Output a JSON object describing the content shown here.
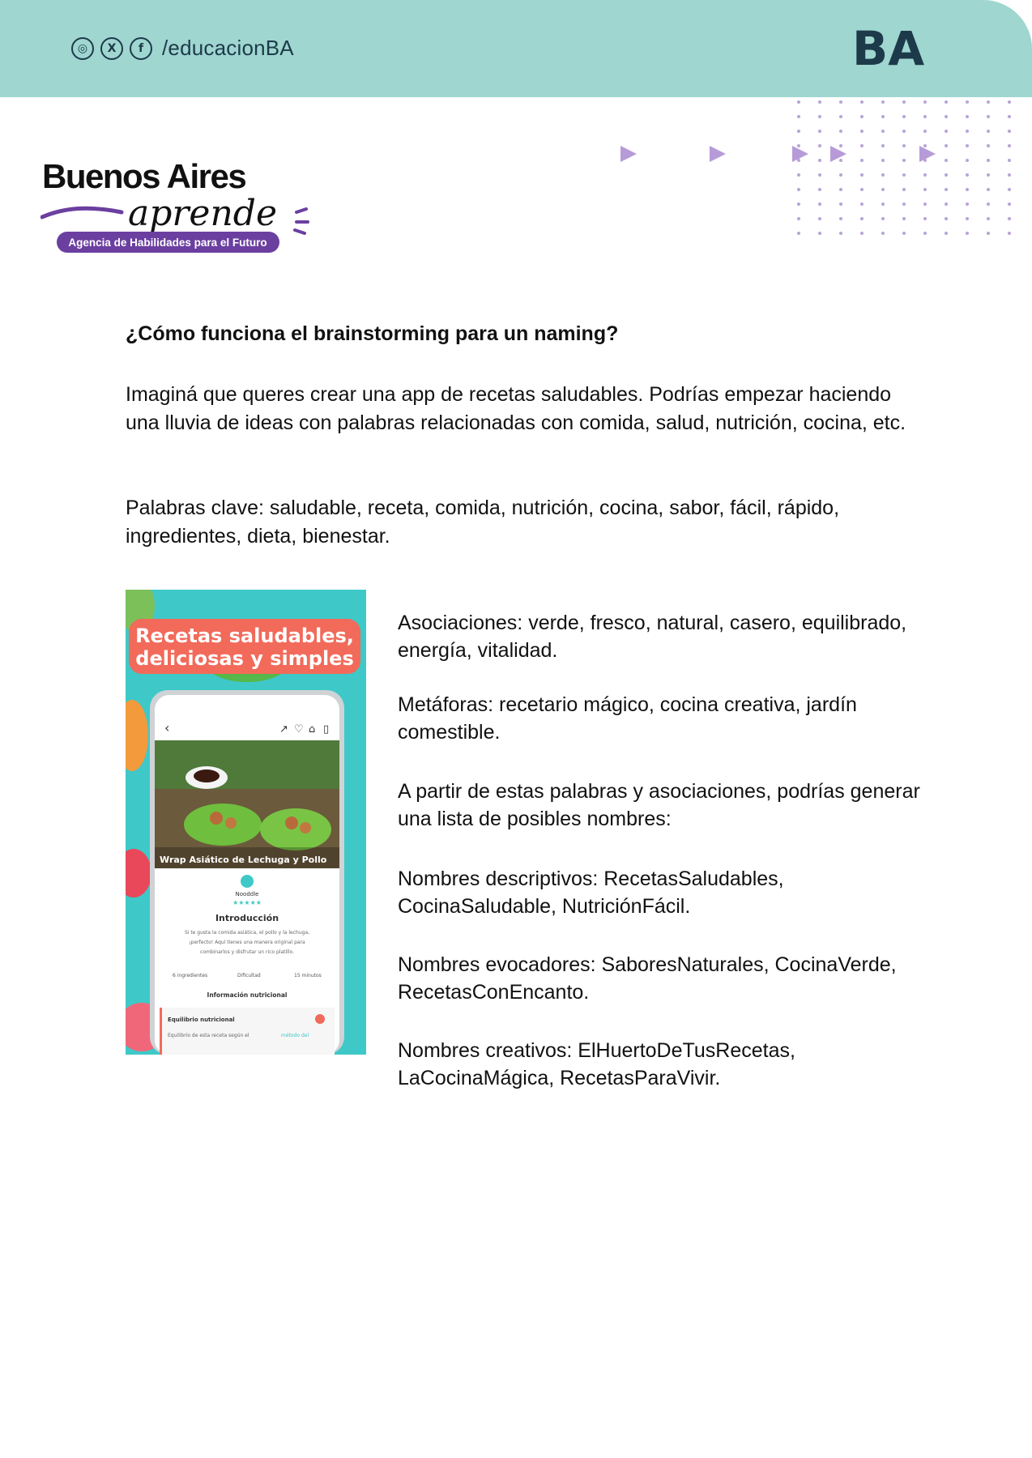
{
  "header": {
    "handle": "/educacionBA",
    "social_icons": [
      "instagram-icon",
      "x-icon",
      "facebook-icon"
    ],
    "logo_text": "BA",
    "bar_color": "#9fd6d0",
    "logo_color": "#1d3a4a"
  },
  "brand": {
    "line1": "Buenos Aires",
    "line2": "aprende",
    "tagline": "Agencia de Habilidades para el Futuro",
    "accent": "#6b3fa0"
  },
  "body": {
    "title": "¿Cómo funciona el brainstorming para un naming?",
    "intro": "Imaginá que queres crear una app de recetas saludables. Podrías empezar haciendo una lluvia de ideas con palabras relacionadas con comida, salud, nutrición, cocina, etc.",
    "keywords": "Palabras clave: saludable, receta, comida, nutrición, cocina, sabor, fácil, rápido, ingredientes, dieta, bienestar.",
    "associations": "Asociaciones: verde, fresco, natural, casero, equilibrado, energía, vitalidad.",
    "metaphors": "Metáforas: recetario mágico, cocina creativa, jardín comestible.",
    "from_words": "A partir de estas palabras y asociaciones, podrías generar una lista de posibles nombres:",
    "descriptive": "Nombres descriptivos: RecetasSaludables, CocinaSaludable, NutriciónFácil.",
    "evocative": "Nombres evocadores: SaboresNaturales, CocinaVerde, RecetasConEncanto.",
    "creative": "Nombres creativos: ElHuertoDeTusRecetas, LaCocinaMágica, RecetasParaVivir."
  },
  "app_image": {
    "headline_1": "Recetas saludables,",
    "headline_2": "deliciosas y simples",
    "recipe_title": "Wrap Asiático de Lechuga y Pollo",
    "author": "Nooddle",
    "section": "Introducción",
    "intro_text_1": "Si te gusta la comida asiática, el pollo y la lechuga,",
    "intro_text_2": "¡perfecto! Aquí tienes una manera original para",
    "intro_text_3": "combinarlos y disfrutar un rico platillo.",
    "stat_ingredients": "6 ingredientes",
    "stat_difficulty": "Dificultad",
    "stat_time": "15 minutos",
    "nutrition_title": "Información nutricional",
    "balance_title": "Equilibrio nutricional",
    "balance_text": "Equilibrio de esta receta según el",
    "balance_link": "método del",
    "bg_color": "#3fc8c8",
    "headline_color": "#f26a5a"
  }
}
